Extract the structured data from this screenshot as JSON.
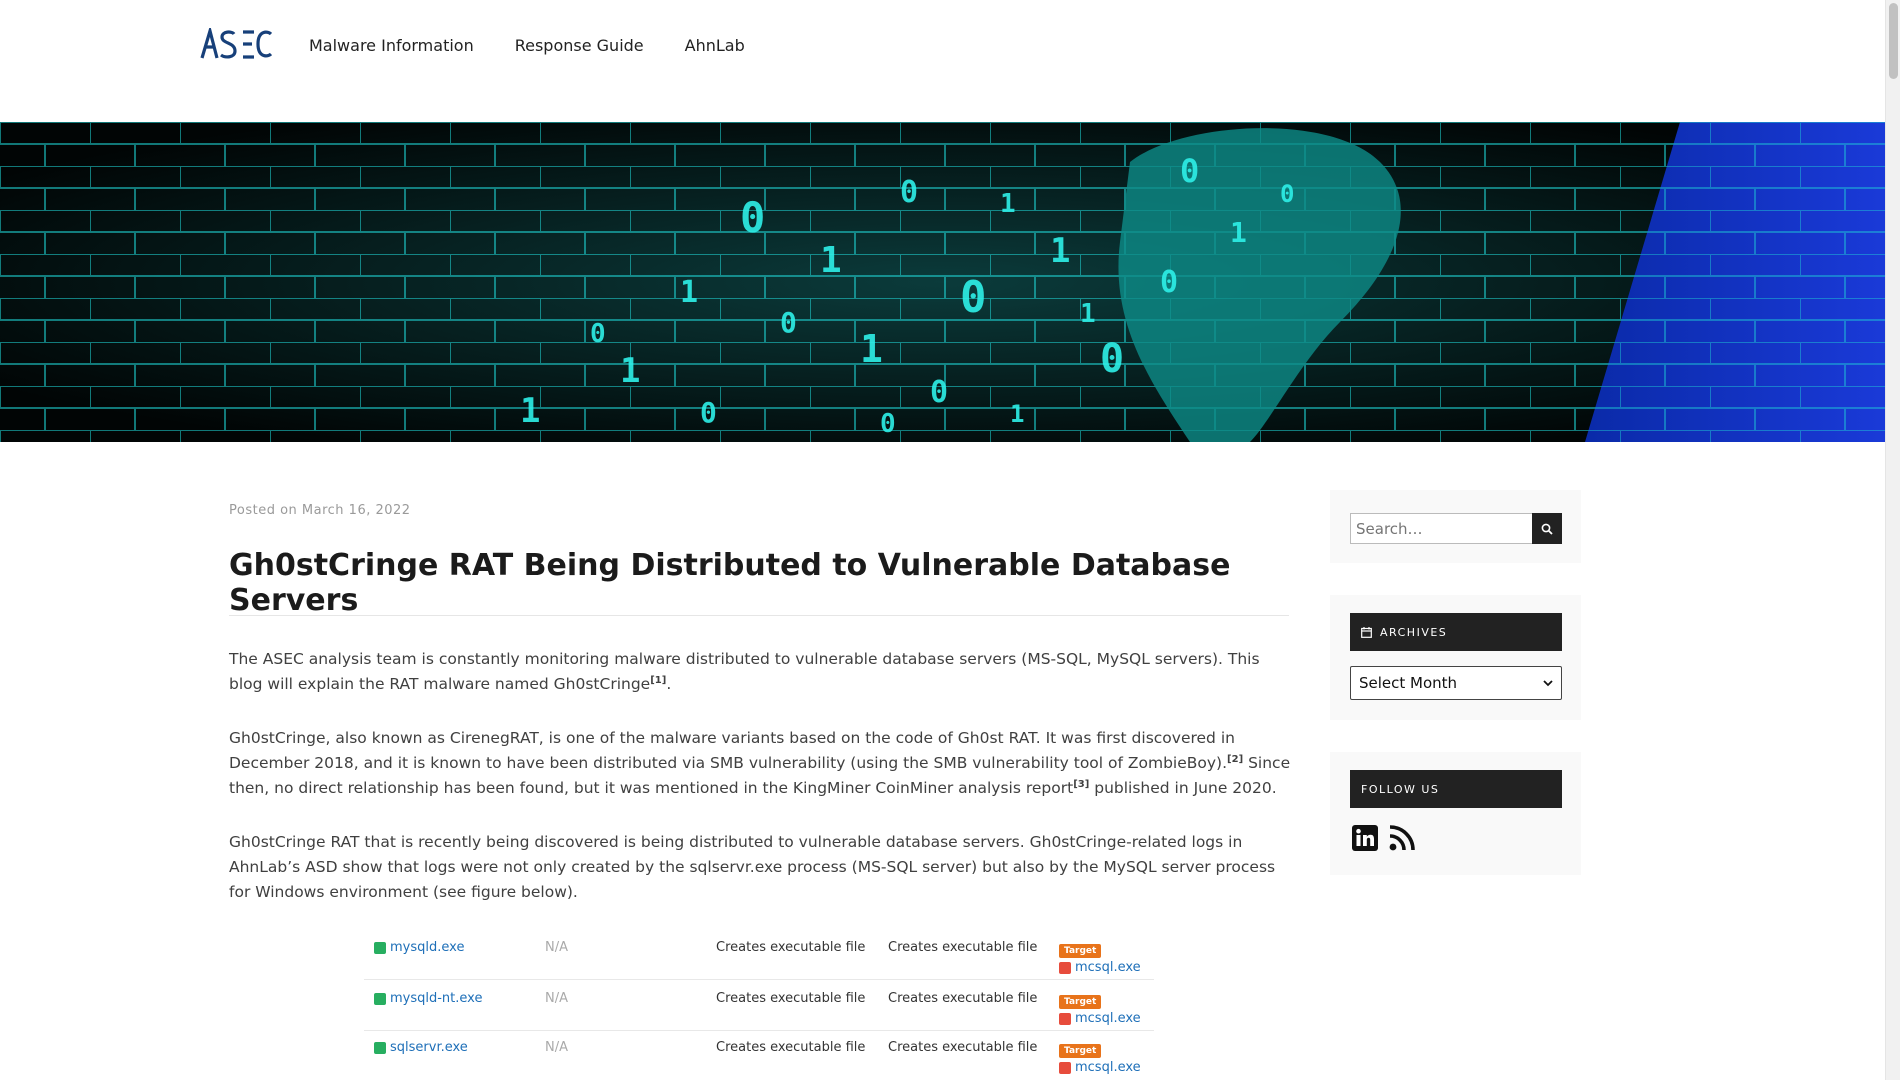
{
  "header": {
    "logo_text": "ASEC",
    "nav": [
      "Malware Information",
      "Response Guide",
      "AhnLab"
    ]
  },
  "post": {
    "meta_prefix": "Posted on",
    "date": "March 16, 2022",
    "title": "Gh0stCringe RAT Being Distributed to Vulnerable Database Servers",
    "p1": {
      "text": "The ASEC analysis team is constantly monitoring malware distributed to vulnerable database servers (MS-SQL, MySQL servers). This blog will explain the RAT malware named Gh0stCringe",
      "ref": "[1]",
      "tail": "."
    },
    "p2": {
      "a": "Gh0stCringe, also known as CirenegRAT, is one of the malware variants based on the code of Gh0st RAT. It was first discovered in December 2018, and it is known to have been distributed via SMB vulnerability (using the SMB vulnerability tool of ZombieBoy).",
      "ref_a": "[2]",
      "b": " Since then, no direct relationship has been found, but it was mentioned in the KingMiner CoinMiner analysis report",
      "ref_b": "[3]",
      "c": " published in June 2020."
    },
    "p3": "Gh0stCringe RAT that is recently being discovered is being distributed to vulnerable database servers. Gh0stCringe-related logs in AhnLab’s ASD show that logs were not only created by the sqlservr.exe process (MS-SQL server) but also by the MySQL server process for Windows environment (see figure below).",
    "figure_rows": [
      {
        "process": "mysqld.exe",
        "na": "N/A",
        "action1": "Creates executable file",
        "action2": "Creates executable file",
        "badge": "Target",
        "target": "mcsql.exe"
      },
      {
        "process": "mysqld-nt.exe",
        "na": "N/A",
        "action1": "Creates executable file",
        "action2": "Creates executable file",
        "badge": "Target",
        "target": "mcsql.exe"
      },
      {
        "process": "sqlservr.exe",
        "na": "N/A",
        "action1": "Creates executable file",
        "action2": "Creates executable file",
        "badge": "Target",
        "target": "mcsql.exe"
      }
    ]
  },
  "sidebar": {
    "search_placeholder": "Search…",
    "archives_title": "ARCHIVES",
    "archives_select": "Select Month",
    "follow_title": "FOLLOW US",
    "social": [
      "linkedin-icon",
      "rss-icon"
    ]
  },
  "colors": {
    "link": "#1e6fb8",
    "badge": "#e8731a",
    "widget_head": "#222222",
    "banner_glow": "#1fe0e0"
  }
}
